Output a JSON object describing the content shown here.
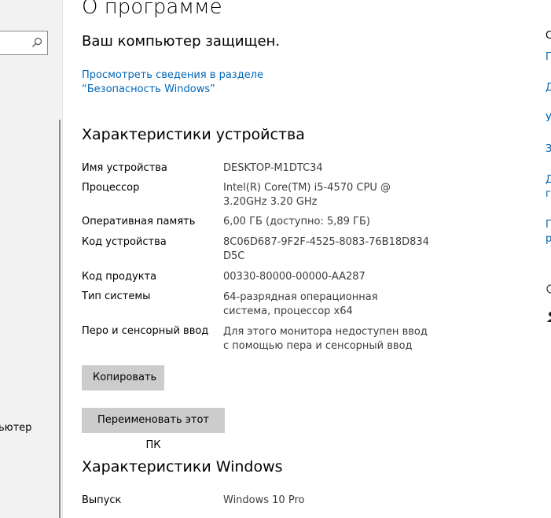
{
  "page_title": "О программе",
  "protected_text": "Ваш компьютер защищен.",
  "security_link": "Просмотреть сведения в разделе “Безопасность Windows”",
  "sidebar": {
    "partial_item": "ьютер"
  },
  "device_specs": {
    "title": "Характеристики устройства",
    "rows": [
      {
        "label": "Имя устройства",
        "value": "DESKTOP-M1DTC34"
      },
      {
        "label": "Процессор",
        "value": "Intel(R) Core(TM) i5-4570 CPU @ 3.20GHz 3.20 GHz"
      },
      {
        "label": "Оперативная память",
        "value": "6,00 ГБ (доступно: 5,89 ГБ)"
      },
      {
        "label": "Код устройства",
        "value": "8C06D687-9F2F-4525-8083-76B18D834D5C"
      },
      {
        "label": "Код продукта",
        "value": "00330-80000-00000-AA287"
      },
      {
        "label": "Тип системы",
        "value": "64-разрядная операционная система, процессор x64"
      },
      {
        "label": "Перо и сенсорный ввод",
        "value": "Для этого монитора недоступен ввод с помощью пера и сенсорный ввод"
      }
    ],
    "copy_button": "Копировать",
    "rename_button": "Переименовать этот ПК"
  },
  "windows_specs": {
    "title": "Характеристики Windows",
    "rows": [
      {
        "label": "Выпуск",
        "value": "Windows 10 Pro"
      }
    ]
  },
  "right_column_partial": [
    "С",
    "П",
    "Д",
    "У",
    "З",
    "Д",
    "г",
    "П",
    "р"
  ],
  "colors": {
    "link": "#0067b8",
    "button_bg": "#cccccc",
    "sidebar_bg": "#f2f2f2"
  }
}
